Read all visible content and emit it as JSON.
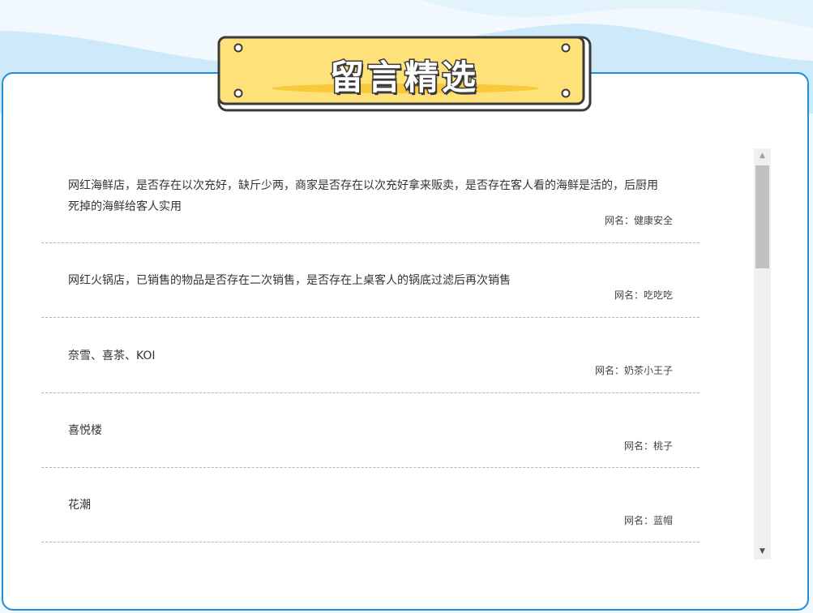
{
  "header": {
    "title": "留言精选"
  },
  "messages": [
    {
      "text": "网红海鲜店，是否存在以次充好，缺斤少两，商家是否存在以次充好拿来贩卖，是否存在客人看的海鲜是活的，后厨用死掉的海鲜给客人实用",
      "author": "网名：健康安全"
    },
    {
      "text": "网红火锅店，已销售的物品是否存在二次销售，是否存在上桌客人的锅底过滤后再次销售",
      "author": "网名：吃吃吃"
    },
    {
      "text": "奈雪、喜茶、KOI",
      "author": "网名：奶茶小王子"
    },
    {
      "text": "喜悦楼",
      "author": "网名：桃子"
    },
    {
      "text": "花潮",
      "author": "网名：蓝帽"
    }
  ],
  "scrollbar": {
    "up_glyph": "▲",
    "down_glyph": "▼",
    "position_fraction": 0
  },
  "colors": {
    "frame_border": "#1f8fd6",
    "badge_fill": "#ffe17a",
    "wave": "#cde9fa"
  }
}
